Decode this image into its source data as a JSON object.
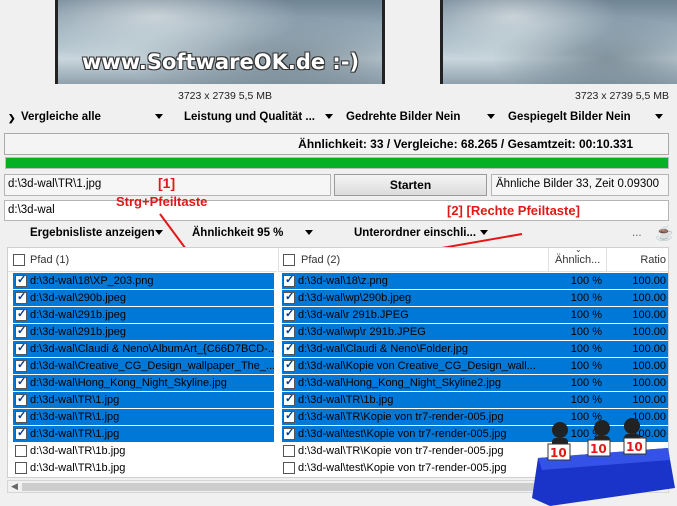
{
  "preview": {
    "watermark": "www.SoftwareOK.de :-)",
    "left_info": "3723 x 2739 5,5 MB",
    "right_info": "3723 x 2739 5,5 MB"
  },
  "options": {
    "compare": "Vergleiche alle",
    "performance": "Leistung und Qualität ...",
    "rotated": "Gedrehte Bilder Nein",
    "mirrored": "Gespiegelt Bilder Nein"
  },
  "status": {
    "text": "Ähnlichkeit: 33 / Vergleiche: 68.265 / Gesamtzeit: 00:10.331",
    "progress_percent": 100
  },
  "path_field": "d:\\3d-wal\\TR\\1.jpg",
  "start_button": "Starten",
  "result_field": "Ähnliche Bilder 33, Zeit 0.09300",
  "folder_field": "d:\\3d-wal",
  "annotations": {
    "a1": "[1]",
    "a1_sub": "Strg+Pfeiltaste",
    "a2": "[2]  [Rechte Pfeiltaste]"
  },
  "toolbar": {
    "results": "Ergebnisliste anzeigen",
    "similarity": "Ähnlichkeit 95 %",
    "subfolders": "Unterordner einschli...",
    "more": "..."
  },
  "table": {
    "col_path1": "Pfad (1)",
    "col_path2": "Pfad (2)",
    "col_sim": "Ähnlich...",
    "col_ratio": "Ratio",
    "rows": [
      {
        "p1": "d:\\3d-wal\\18\\XP_203.png",
        "p2": "d:\\3d-wal\\18\\z.png",
        "sim": "100 %",
        "ratio": "100.00",
        "sel": true
      },
      {
        "p1": "d:\\3d-wal\\290b.jpeg",
        "p2": "d:\\3d-wal\\wp\\290b.jpeg",
        "sim": "100 %",
        "ratio": "100.00",
        "sel": true
      },
      {
        "p1": "d:\\3d-wal\\291b.jpeg",
        "p2": "d:\\3d-wal\\r 291b.JPEG",
        "sim": "100 %",
        "ratio": "100.00",
        "sel": true
      },
      {
        "p1": "d:\\3d-wal\\291b.jpeg",
        "p2": "d:\\3d-wal\\wp\\r 291b.JPEG",
        "sim": "100 %",
        "ratio": "100.00",
        "sel": true
      },
      {
        "p1": "d:\\3d-wal\\Claudi & Neno\\AlbumArt_{C66D7BCD-...",
        "p2": "d:\\3d-wal\\Claudi & Neno\\Folder.jpg",
        "sim": "100 %",
        "ratio": "100.00",
        "sel": true
      },
      {
        "p1": "d:\\3d-wal\\Creative_CG_Design_wallpaper_The_...",
        "p2": "d:\\3d-wal\\Kopie von Creative_CG_Design_wall...",
        "sim": "100 %",
        "ratio": "100.00",
        "sel": true
      },
      {
        "p1": "d:\\3d-wal\\Hong_Kong_Night_Skyline.jpg",
        "p2": "d:\\3d-wal\\Hong_Kong_Night_Skyline2.jpg",
        "sim": "100 %",
        "ratio": "100.00",
        "sel": true
      },
      {
        "p1": "d:\\3d-wal\\TR\\1.jpg",
        "p2": "d:\\3d-wal\\TR\\1b.jpg",
        "sim": "100 %",
        "ratio": "100.00",
        "sel": true
      },
      {
        "p1": "d:\\3d-wal\\TR\\1.jpg",
        "p2": "d:\\3d-wal\\TR\\Kopie von tr7-render-005.jpg",
        "sim": "100 %",
        "ratio": "100.00",
        "sel": true
      },
      {
        "p1": "d:\\3d-wal\\TR\\1.jpg",
        "p2": "d:\\3d-wal\\test\\Kopie von tr7-render-005.jpg",
        "sim": "100 %",
        "ratio": "100.00",
        "sel": true
      },
      {
        "p1": "d:\\3d-wal\\TR\\1b.jpg",
        "p2": "d:\\3d-wal\\TR\\Kopie von tr7-render-005.jpg",
        "sim": "",
        "ratio": "",
        "sel": false
      },
      {
        "p1": "d:\\3d-wal\\TR\\1b.jpg",
        "p2": "d:\\3d-wal\\test\\Kopie von tr7-render-005.jpg",
        "sim": "",
        "ratio": "",
        "sel": false
      }
    ]
  },
  "colors": {
    "selection": "#0078d7",
    "progress": "#06b025",
    "annotation": "#e01818"
  }
}
